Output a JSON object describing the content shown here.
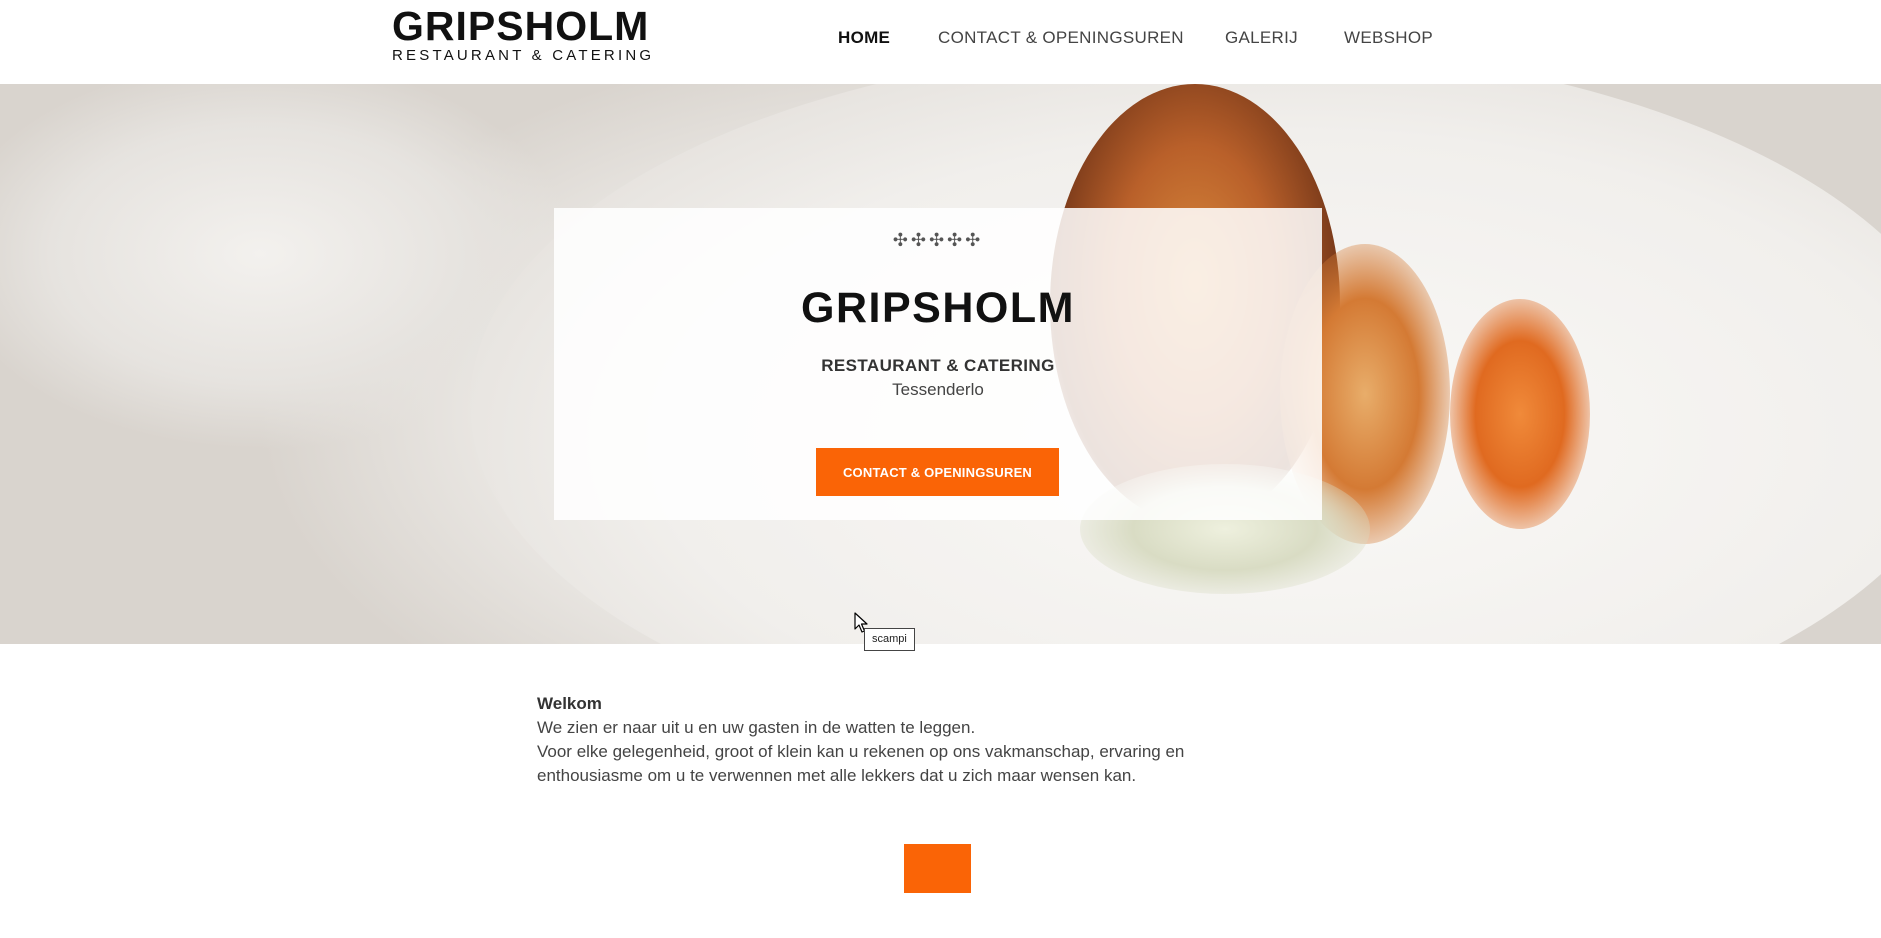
{
  "header": {
    "logo_title": "GRIPSHOLM",
    "logo_subtitle": "RESTAURANT & CATERING"
  },
  "nav": {
    "items": [
      {
        "label": "HOME",
        "active": true
      },
      {
        "label": "CONTACT & OPENINGSUREN",
        "active": false
      },
      {
        "label": "GALERIJ",
        "active": false
      },
      {
        "label": "WEBSHOP",
        "active": false
      }
    ]
  },
  "hero": {
    "ornament": "✣✣✣✣✣",
    "title": "GRIPSHOLM",
    "subtitle": "RESTAURANT & CATERING",
    "location": "Tessenderlo",
    "cta_label": "CONTACT & OPENINGSUREN",
    "image_tooltip": "scampi"
  },
  "welcome": {
    "heading": "Welkom",
    "line1": "We zien er naar uit u en uw gasten in de watten te leggen.",
    "line2": "Voor elke gelegenheid, groot of klein kan u rekenen op ons vakmanschap, ervaring en enthousiasme om u te verwennen met alle lekkers dat u zich maar wensen kan."
  },
  "colors": {
    "accent": "#fa6406",
    "text": "#333333"
  },
  "icons": {
    "cursor": "mouse-pointer-icon",
    "ornament": "ornament-icon"
  }
}
